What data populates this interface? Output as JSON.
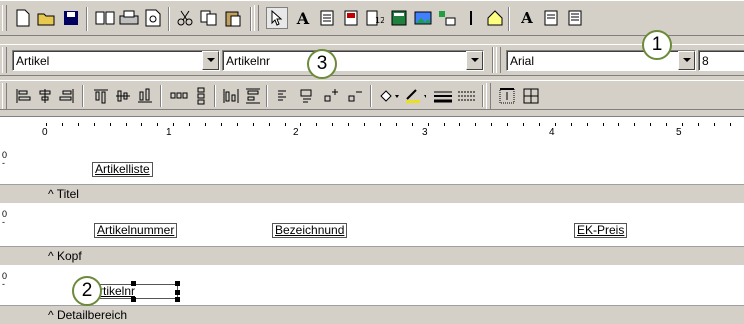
{
  "toolbar2": {
    "table_combo": "Artikel",
    "field_combo": "Artikelnr",
    "font_combo": "Arial",
    "size_combo": "8"
  },
  "ruler": {
    "labels": [
      "0",
      "1",
      "2",
      "3",
      "4",
      "5"
    ]
  },
  "bands": {
    "titel": {
      "label": "^ Titel",
      "marker": "0"
    },
    "kopf": {
      "label": "^ Kopf",
      "marker": "0"
    },
    "detail": {
      "label": "^ Detailbereich",
      "marker": "0"
    }
  },
  "fields": {
    "title_field": "Artikelliste",
    "col1": "Artikelnummer",
    "col2": "Bezeichnund",
    "col3": "EK-Preis",
    "detail_field": "rtikelnr"
  },
  "callouts": [
    "1",
    "2",
    "3"
  ],
  "colors": {
    "callout_border": "#6b8a3a",
    "face": "#d4d0c8"
  }
}
